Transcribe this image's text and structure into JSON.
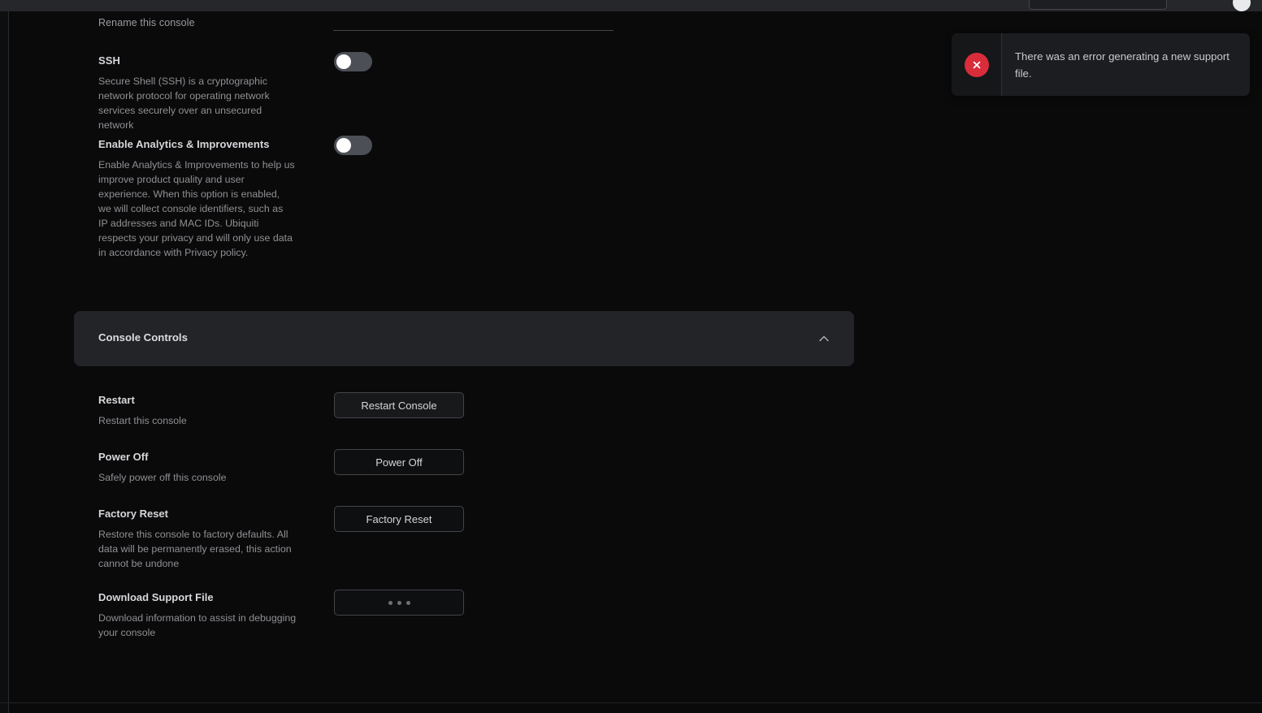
{
  "topbar": {
    "search_placeholder": "",
    "search_value": "",
    "avatar_label": ""
  },
  "settings": {
    "rename": {
      "value": "",
      "description": "Rename this console"
    },
    "ssh": {
      "title": "SSH",
      "description": "Secure Shell (SSH) is a cryptographic network protocol for operating network services securely over an unsecured network",
      "state": "off"
    },
    "analytics": {
      "title": "Enable Analytics & Improvements",
      "description": "Enable Analytics & Improvements to help us improve product quality and user experience. When this option is enabled, we will collect console identifiers, such as IP addresses and MAC IDs. Ubiquiti respects your privacy and will only use data in accordance with Privacy policy.",
      "state": "off"
    }
  },
  "console_controls": {
    "section_title": "Console Controls",
    "collapse_icon": "chevron-up-icon",
    "expanded": true,
    "rows": [
      {
        "title": "Restart",
        "description": "Restart this console",
        "button_label": "Restart Console",
        "button_state": "hover"
      },
      {
        "title": "Power Off",
        "description": "Safely power off this console",
        "button_label": "Power Off",
        "button_state": "default"
      },
      {
        "title": "Factory Reset",
        "description": "Restore this console to factory defaults. All data will be permanently erased, this action cannot be undone",
        "button_label": "Factory Reset",
        "button_state": "default"
      },
      {
        "title": "Download Support File",
        "description": "Download information to assist in debugging your console",
        "button_label": "",
        "button_state": "loading"
      }
    ]
  },
  "toast": {
    "icon": "error-x-icon",
    "message": "There was an error generating a new support file.",
    "accent_color": "#d92d3c"
  },
  "colors": {
    "page_background": "#0a0a0b",
    "topbar_background": "#26272a",
    "card_background": "#232427",
    "toast_background": "#1c1d20",
    "toggle_track": "#4c4f56",
    "toggle_knob": "#ffffff",
    "border": "#44454a",
    "text_primary": "#d6d7da",
    "text_secondary": "#8f9093"
  }
}
